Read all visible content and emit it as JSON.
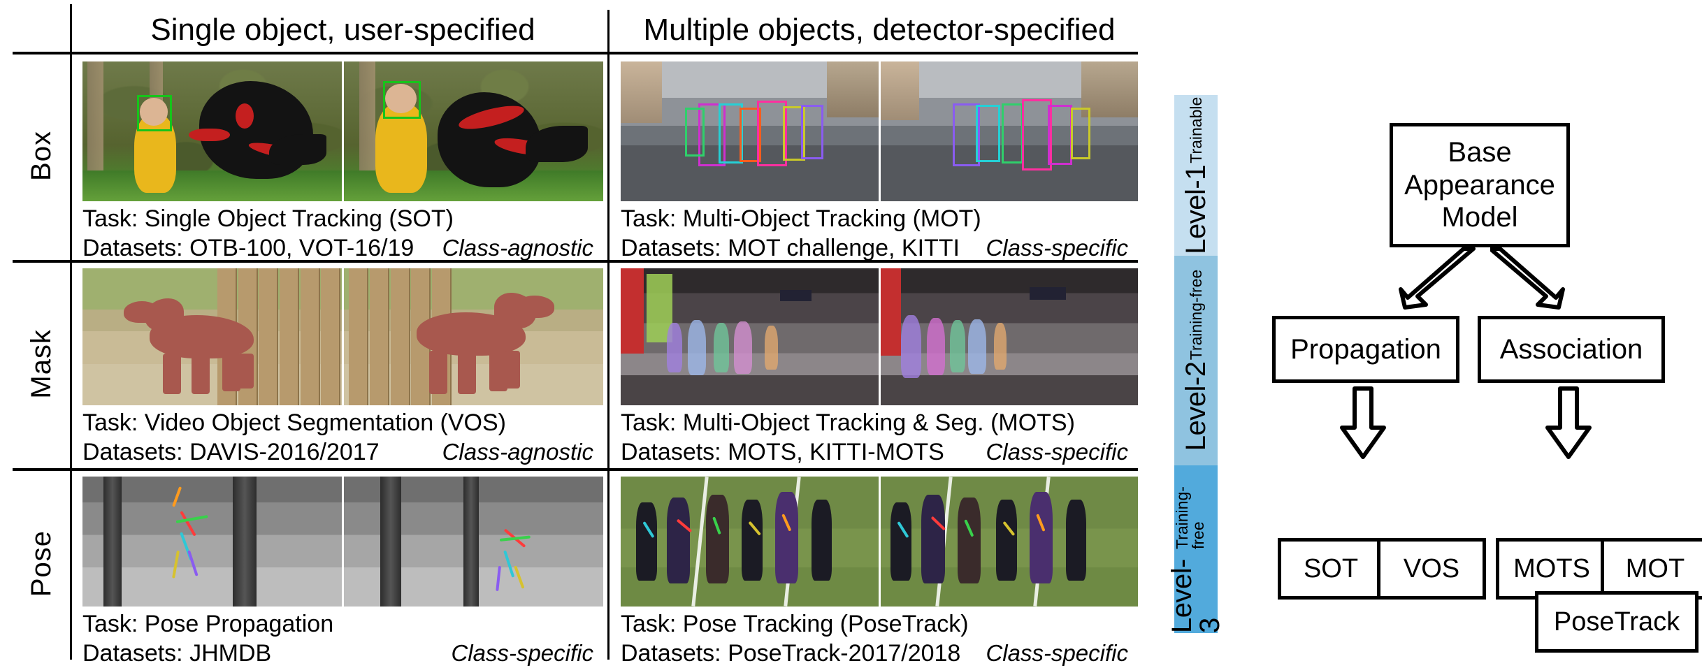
{
  "figure": {
    "columns": [
      {
        "id": "col1",
        "header": "Single object, user-specified"
      },
      {
        "id": "col2",
        "header": "Multiple objects, detector-specified"
      }
    ],
    "row_labels": [
      "Box",
      "Mask",
      "Pose"
    ],
    "cells": [
      {
        "row": "Box",
        "column": "col1",
        "task": "Task: Single Object Tracking (SOT)",
        "datasets": "Datasets: OTB-100, VOT-16/19",
        "tag": "Class-agnostic",
        "scene": "baby-vs-bear-green-box"
      },
      {
        "row": "Box",
        "column": "col2",
        "task": "Task: Multi-Object Tracking (MOT)",
        "datasets": "Datasets: MOT challenge, KITTI",
        "tag": "Class-specific",
        "scene": "street-pedestrians-bboxes"
      },
      {
        "row": "Mask",
        "column": "col1",
        "task": "Task: Video Object Segmentation (VOS)",
        "datasets": "Datasets: DAVIS-2016/2017",
        "tag": "Class-agnostic",
        "scene": "camel-mask"
      },
      {
        "row": "Mask",
        "column": "col2",
        "task": "Task: Multi-Object Tracking & Seg. (MOTS)",
        "datasets": "Datasets: MOTS, KITTI-MOTS",
        "tag": "Class-specific",
        "scene": "mall-people-masks"
      },
      {
        "row": "Pose",
        "column": "col1",
        "task": "Task: Pose Propagation",
        "datasets": "Datasets: JHMDB",
        "tag": "Class-specific",
        "scene": "grayscale-skeleton"
      },
      {
        "row": "Pose",
        "column": "col2",
        "task": "Task: Pose Tracking (PoseTrack)",
        "datasets": "Datasets: PoseTrack-2017/2018",
        "tag": "Class-specific",
        "scene": "field-multi-skeleton"
      }
    ]
  },
  "diagram": {
    "levels": [
      {
        "name": "Level-1",
        "subtitle": "Trainable",
        "color": "#c5dff0"
      },
      {
        "name": "Level-2",
        "subtitle": "Training-free",
        "color": "#8fc3e0"
      },
      {
        "name": "Level-3",
        "subtitle": "Training-free",
        "color": "#52aadc"
      }
    ],
    "base_box": "Base\nAppearance\nModel",
    "base_box_lines": [
      "Base",
      "Appearance",
      "Model"
    ],
    "level2_boxes": [
      "Propagation",
      "Association"
    ],
    "level3_boxes": [
      "SOT",
      "VOS",
      "MOTS",
      "MOT"
    ],
    "level3_extra_box": "PoseTrack",
    "arrows": [
      {
        "name": "base-to-propagation",
        "direction": "down-left"
      },
      {
        "name": "base-to-association",
        "direction": "down-right"
      },
      {
        "name": "propagation-to-sot-vos",
        "direction": "down"
      },
      {
        "name": "association-to-mots-mot",
        "direction": "down"
      }
    ]
  }
}
